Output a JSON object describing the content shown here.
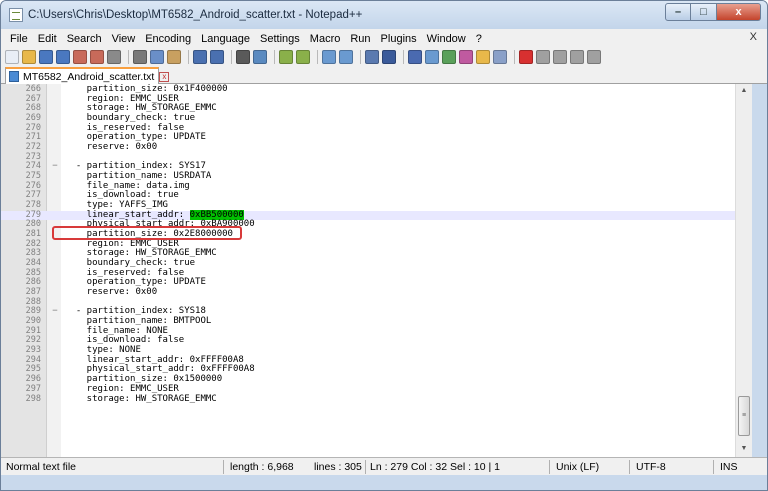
{
  "window": {
    "title": "C:\\Users\\Chris\\Desktop\\MT6582_Android_scatter.txt - Notepad++",
    "app_icon": "notepadpp-icon",
    "controls": {
      "minimize": "–",
      "maximize": "□",
      "close": "x"
    }
  },
  "menu": {
    "items": [
      "File",
      "Edit",
      "Search",
      "View",
      "Encoding",
      "Language",
      "Settings",
      "Macro",
      "Run",
      "Plugins",
      "Window",
      "?"
    ],
    "close": "X"
  },
  "toolbar": {
    "buttons": [
      {
        "icon": "new-file-icon",
        "color": "#e9eef6"
      },
      {
        "icon": "open-file-icon",
        "color": "#e8b84a"
      },
      {
        "icon": "save-icon",
        "color": "#4a78c0"
      },
      {
        "icon": "save-all-icon",
        "color": "#4a78c0"
      },
      {
        "icon": "close-file-icon",
        "color": "#c86a5a"
      },
      {
        "icon": "close-all-icon",
        "color": "#c86a5a"
      },
      {
        "icon": "print-icon",
        "color": "#8a8a8a"
      },
      {
        "sep": true
      },
      {
        "icon": "cut-icon",
        "color": "#7a7a7a"
      },
      {
        "icon": "copy-icon",
        "color": "#6a8fc8"
      },
      {
        "icon": "paste-icon",
        "color": "#c8a060"
      },
      {
        "sep": true
      },
      {
        "icon": "undo-icon",
        "color": "#4a70b0"
      },
      {
        "icon": "redo-icon",
        "color": "#4a70b0"
      },
      {
        "sep": true
      },
      {
        "icon": "find-icon",
        "color": "#5a5a5a"
      },
      {
        "icon": "replace-icon",
        "color": "#5a8ac0"
      },
      {
        "sep": true
      },
      {
        "icon": "zoom-in-icon",
        "color": "#8ab04a"
      },
      {
        "icon": "zoom-out-icon",
        "color": "#8ab04a"
      },
      {
        "sep": true
      },
      {
        "icon": "sync-vertical-icon",
        "color": "#6a9ad0"
      },
      {
        "icon": "sync-horizontal-icon",
        "color": "#6a9ad0"
      },
      {
        "sep": true
      },
      {
        "icon": "word-wrap-icon",
        "color": "#5a7ab0"
      },
      {
        "icon": "show-all-chars-icon",
        "color": "#3a5a9a"
      },
      {
        "sep": true
      },
      {
        "icon": "indent-guide-icon",
        "color": "#4a6ab0"
      },
      {
        "icon": "udl-icon",
        "color": "#6a9ad0"
      },
      {
        "icon": "doc-map-icon",
        "color": "#5aa05a"
      },
      {
        "icon": "function-list-icon",
        "color": "#c05aa0"
      },
      {
        "icon": "folder-workspace-icon",
        "color": "#e8b84a"
      },
      {
        "icon": "monitoring-icon",
        "color": "#8aa0c8"
      },
      {
        "sep": true
      },
      {
        "icon": "record-macro-icon",
        "color": "#d83030"
      },
      {
        "icon": "stop-macro-icon",
        "color": "#a0a0a0"
      },
      {
        "icon": "play-macro-icon",
        "color": "#a0a0a0"
      },
      {
        "icon": "play-multiple-icon",
        "color": "#a0a0a0"
      },
      {
        "icon": "save-macro-icon",
        "color": "#a0a0a0"
      }
    ]
  },
  "tab": {
    "label": "MT6582_Android_scatter.txt",
    "close": "x",
    "icon": "text-file-icon"
  },
  "editor": {
    "current_line": 279,
    "lines": [
      {
        "n": "266",
        "fold": "",
        "text": "    partition_size: 0x1F400000"
      },
      {
        "n": "267",
        "fold": "",
        "text": "    region: EMMC_USER"
      },
      {
        "n": "268",
        "fold": "",
        "text": "    storage: HW_STORAGE_EMMC"
      },
      {
        "n": "269",
        "fold": "",
        "text": "    boundary_check: true"
      },
      {
        "n": "270",
        "fold": "",
        "text": "    is_reserved: false"
      },
      {
        "n": "271",
        "fold": "",
        "text": "    operation_type: UPDATE"
      },
      {
        "n": "272",
        "fold": "",
        "text": "    reserve: 0x00"
      },
      {
        "n": "273",
        "fold": "",
        "text": ""
      },
      {
        "n": "274",
        "fold": "−",
        "text": "  - partition_index: SYS17"
      },
      {
        "n": "275",
        "fold": "",
        "text": "    partition_name: USRDATA"
      },
      {
        "n": "276",
        "fold": "",
        "text": "    file_name: data.img"
      },
      {
        "n": "277",
        "fold": "",
        "text": "    is_download: true"
      },
      {
        "n": "278",
        "fold": "",
        "text": "    type: YAFFS_IMG"
      },
      {
        "n": "279",
        "fold": "",
        "text": "    linear_start_addr: ",
        "highlight": "0xBB500000"
      },
      {
        "n": "280",
        "fold": "",
        "text": "    physical_start_addr: 0xBA900000"
      },
      {
        "n": "281",
        "fold": "",
        "text": "    partition_size: 0x2E8000000"
      },
      {
        "n": "282",
        "fold": "",
        "text": "    region: EMMC_USER"
      },
      {
        "n": "283",
        "fold": "",
        "text": "    storage: HW_STORAGE_EMMC"
      },
      {
        "n": "284",
        "fold": "",
        "text": "    boundary_check: true"
      },
      {
        "n": "285",
        "fold": "",
        "text": "    is_reserved: false"
      },
      {
        "n": "286",
        "fold": "",
        "text": "    operation_type: UPDATE"
      },
      {
        "n": "287",
        "fold": "",
        "text": "    reserve: 0x00"
      },
      {
        "n": "288",
        "fold": "",
        "text": ""
      },
      {
        "n": "289",
        "fold": "−",
        "text": "  - partition_index: SYS18"
      },
      {
        "n": "290",
        "fold": "",
        "text": "    partition_name: BMTPOOL"
      },
      {
        "n": "291",
        "fold": "",
        "text": "    file_name: NONE"
      },
      {
        "n": "292",
        "fold": "",
        "text": "    is_download: false"
      },
      {
        "n": "293",
        "fold": "",
        "text": "    type: NONE"
      },
      {
        "n": "294",
        "fold": "",
        "text": "    linear_start_addr: 0xFFFF00A8"
      },
      {
        "n": "295",
        "fold": "",
        "text": "    physical_start_addr: 0xFFFF00A8"
      },
      {
        "n": "296",
        "fold": "",
        "text": "    partition_size: 0x1500000"
      },
      {
        "n": "297",
        "fold": "",
        "text": "    region: EMMC_USER"
      },
      {
        "n": "298",
        "fold": "",
        "text": "    storage: HW_STORAGE_EMMC"
      }
    ],
    "annotation_color": "#d83a3a",
    "highlight_color": "#00c000"
  },
  "status": {
    "file_type": "Normal text file",
    "length": "length : 6,968",
    "lines": "lines : 305",
    "position": "Ln : 279    Col : 32    Sel : 10 | 1",
    "eol": "Unix (LF)",
    "encoding": "UTF-8",
    "mode": "INS"
  }
}
